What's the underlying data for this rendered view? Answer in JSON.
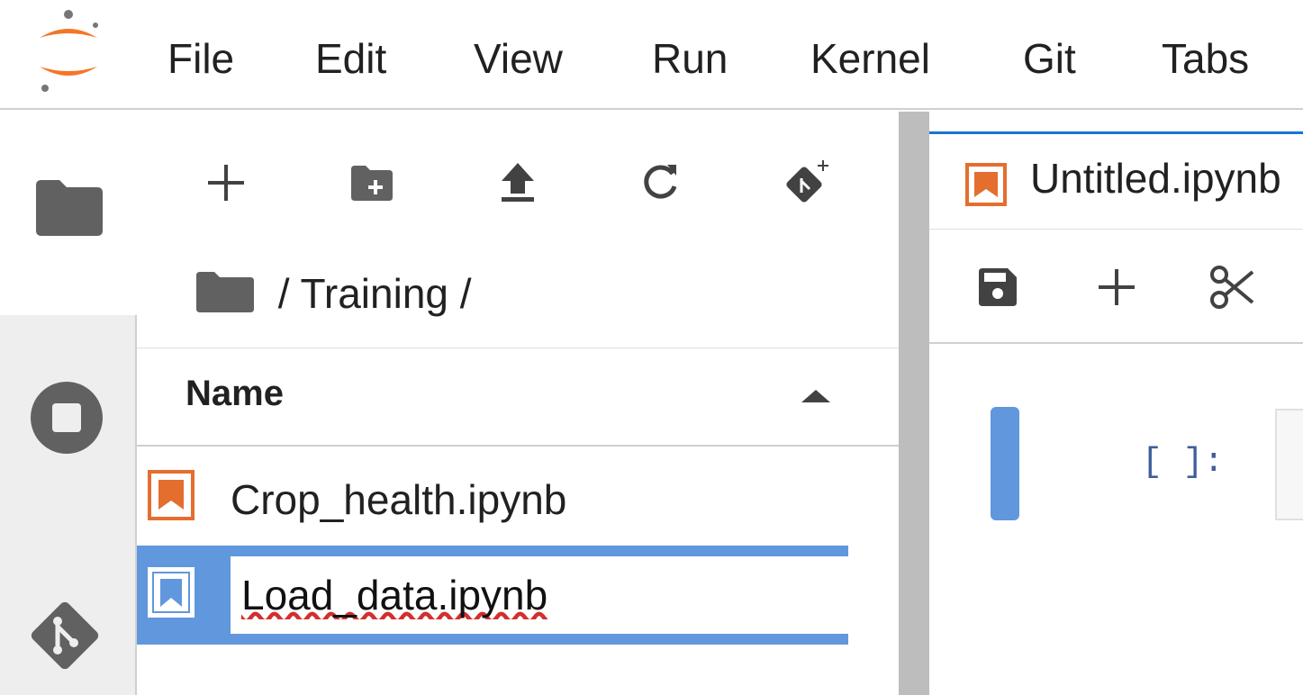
{
  "menubar": {
    "items": [
      "File",
      "Edit",
      "View",
      "Run",
      "Kernel",
      "Git",
      "Tabs"
    ]
  },
  "activity_bar": {
    "icons": [
      "folder-icon",
      "stop-circle-icon",
      "git-icon"
    ]
  },
  "file_browser": {
    "toolbar_icons": [
      "plus-icon",
      "new-folder-icon",
      "upload-icon",
      "refresh-icon",
      "git-clone-icon"
    ],
    "breadcrumb": " / Training /",
    "column_header": "Name",
    "sort_direction": "ascending",
    "files": [
      {
        "name": "Crop_health.ipynb",
        "icon_color": "#e46e2e",
        "selected": false
      },
      {
        "name": "Load_data.ipynb",
        "icon_color": "#6197dc",
        "selected": true,
        "renaming": true
      }
    ]
  },
  "notebook": {
    "tab_title": "Untitled.ipynb",
    "toolbar_icons": [
      "save-icon",
      "plus-icon",
      "cut-icon"
    ],
    "cell_prompt": "[ ]:"
  },
  "colors": {
    "accent": "#1976d2",
    "selection": "#6197dc",
    "notebook_orange": "#e46e2e",
    "icon_gray": "#616161"
  }
}
